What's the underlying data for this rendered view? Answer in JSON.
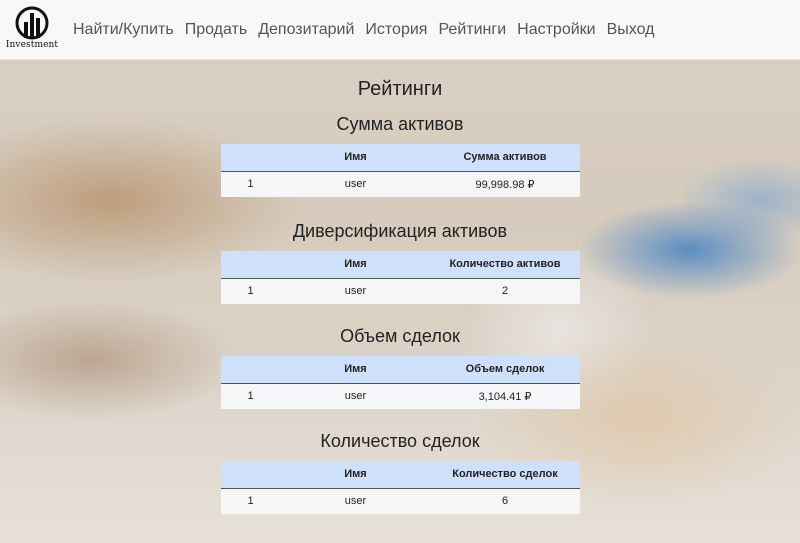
{
  "brand": {
    "name": "Investment",
    "logo_icon": "bar-chart-circle-icon"
  },
  "nav": {
    "items": [
      {
        "label": "Найти/Купить"
      },
      {
        "label": "Продать"
      },
      {
        "label": "Депозитарий"
      },
      {
        "label": "История"
      },
      {
        "label": "Рейтинги"
      },
      {
        "label": "Настройки"
      },
      {
        "label": "Выход"
      }
    ]
  },
  "page": {
    "title": "Рейтинги"
  },
  "sections": [
    {
      "title": "Сумма активов",
      "columns": [
        "",
        "Имя",
        "Сумма активов"
      ],
      "rows": [
        [
          "1",
          "user",
          "99,998.98 ₽"
        ]
      ]
    },
    {
      "title": "Диверсификация активов",
      "columns": [
        "",
        "Имя",
        "Количество активов"
      ],
      "rows": [
        [
          "1",
          "user",
          "2"
        ]
      ]
    },
    {
      "title": "Объем сделок",
      "columns": [
        "",
        "Имя",
        "Объем сделок"
      ],
      "rows": [
        [
          "1",
          "user",
          "3,104.41 ₽"
        ]
      ]
    },
    {
      "title": "Количество сделок",
      "columns": [
        "",
        "Имя",
        "Количество сделок"
      ],
      "rows": [
        [
          "1",
          "user",
          "6"
        ]
      ]
    }
  ],
  "colors": {
    "navbar_bg": "#f8f8f8",
    "table_header_bg": "#cfe0fb",
    "table_row_bg": "#f5f6f8"
  }
}
